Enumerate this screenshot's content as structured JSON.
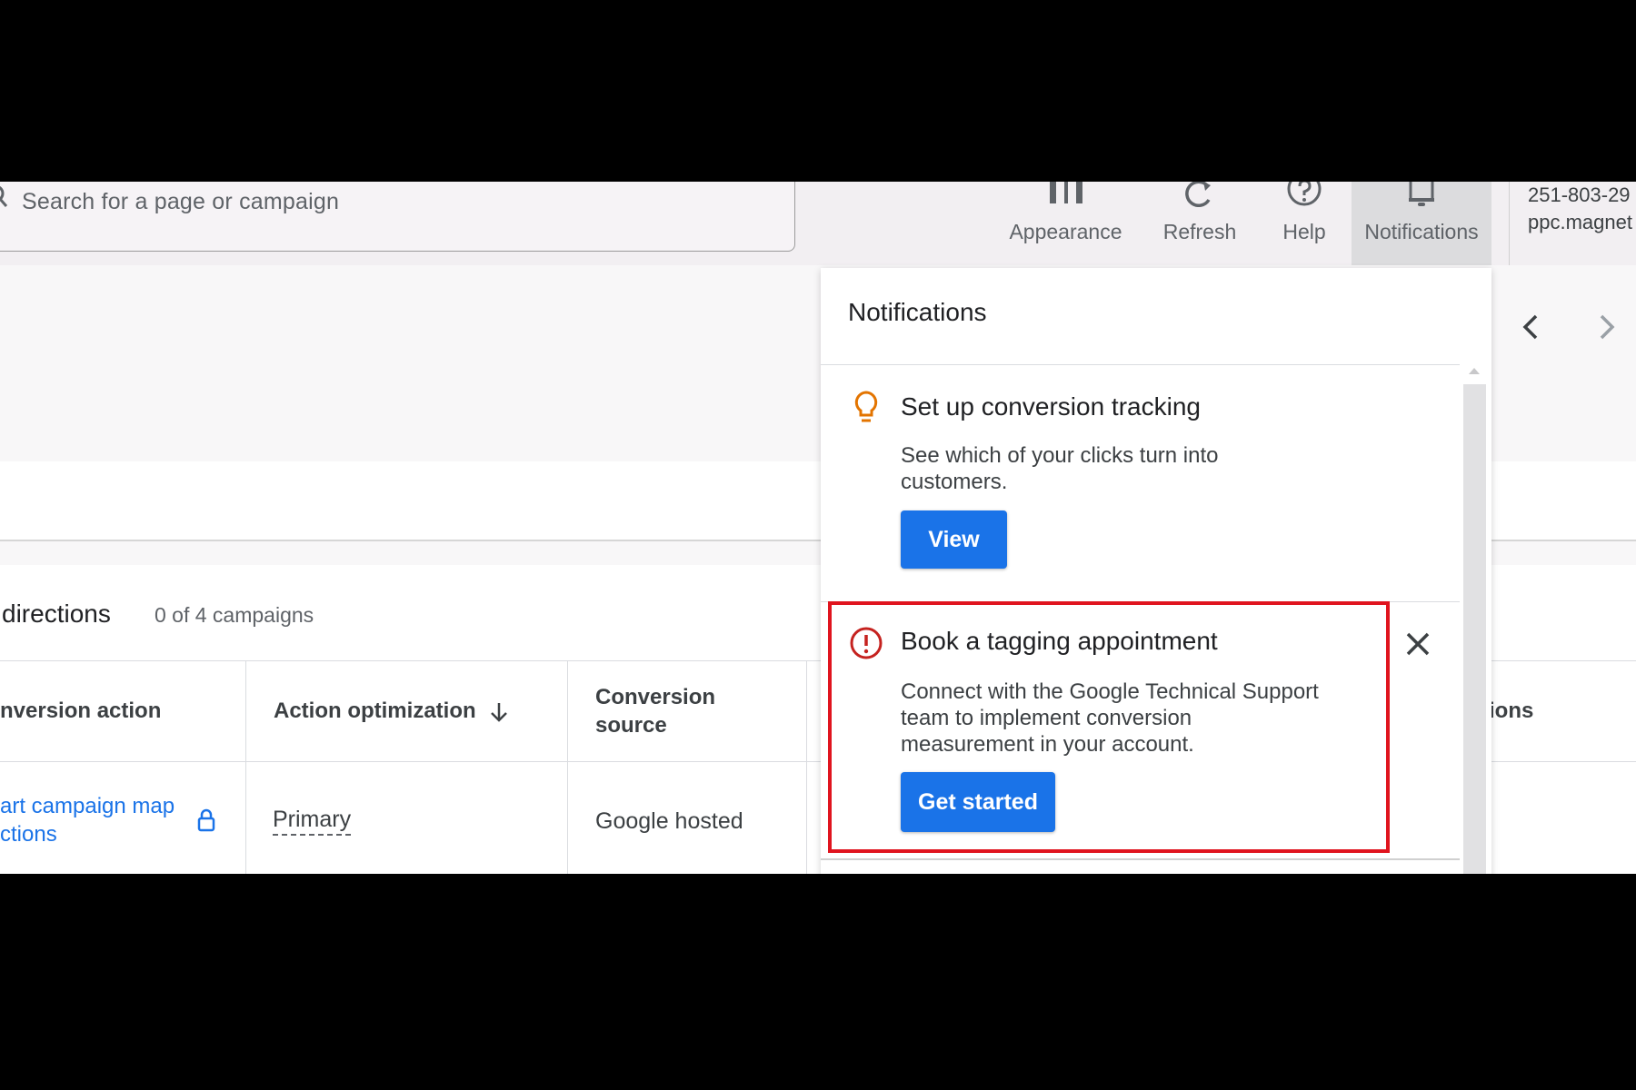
{
  "search": {
    "placeholder": "Search for a page or campaign"
  },
  "toolbar": {
    "appearance": "Appearance",
    "refresh": "Refresh",
    "help": "Help",
    "notifications": "Notifications"
  },
  "account": {
    "phone": "251-803-29",
    "name": "ppc.magnet"
  },
  "card": {
    "title": "directions",
    "count": "0 of 4 campaigns"
  },
  "table": {
    "headers": {
      "conversion_action": "nversion action",
      "action_optimization": "Action optimization",
      "conversion_source_line1": "Conversion",
      "conversion_source_line2": "source",
      "actions": "tions"
    },
    "row": {
      "action_line1": "art campaign map",
      "action_line2": "ctions",
      "optimization": "Primary",
      "source": "Google hosted"
    }
  },
  "notifications_panel": {
    "title": "Notifications",
    "items": [
      {
        "title": "Set up conversion tracking",
        "body_line1": "See which of your clicks turn into",
        "body_line2": "customers.",
        "button": "View",
        "icon": "lightbulb-icon"
      },
      {
        "title": "Book a tagging appointment",
        "body_line1": "Connect with the Google Technical Support",
        "body_line2": "team to implement conversion",
        "body_line3": "measurement in your account.",
        "button": "Get started",
        "icon": "alert-circle-icon"
      }
    ]
  },
  "colors": {
    "accent": "#1a73e8",
    "alert": "#c5221f",
    "highlight": "#e0141e",
    "tip": "#e37400"
  }
}
